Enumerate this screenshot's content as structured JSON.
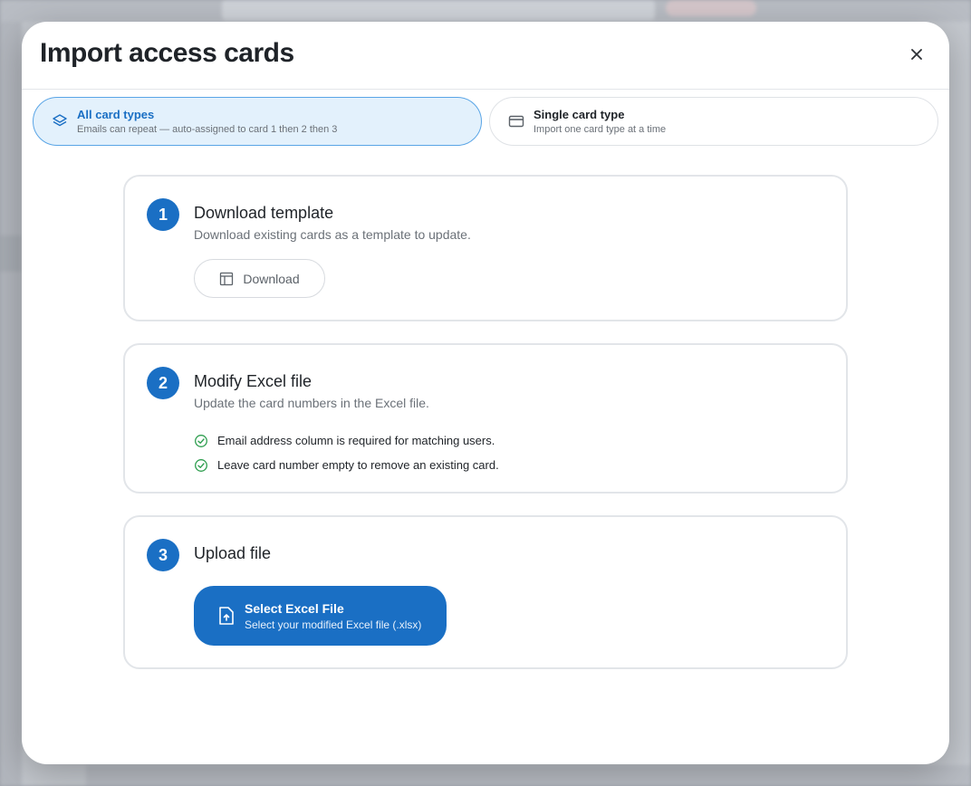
{
  "modal": {
    "title": "Import access cards",
    "close_icon": "close-icon"
  },
  "card_types": [
    {
      "label": "All card types",
      "description": "Emails can repeat — auto-assigned to card 1 then 2 then 3",
      "icon": "layers-icon",
      "selected": true
    },
    {
      "label": "Single card type",
      "description": "Import one card type at a time",
      "icon": "credit-card-icon",
      "selected": false
    }
  ],
  "steps": [
    {
      "number": "1",
      "title": "Download template",
      "description": "Download existing cards as a template to update.",
      "button_label": "Download",
      "button_icon": "table-icon"
    },
    {
      "number": "2",
      "title": "Modify Excel file",
      "description": "Update the card numbers in the Excel file.",
      "checks": [
        "Email address column is required for matching users.",
        "Leave card number empty to remove an existing card."
      ],
      "check_icon": "check-circle-icon"
    },
    {
      "number": "3",
      "title": "Upload file",
      "button_title": "Select Excel File",
      "button_subtitle": "Select your modified Excel file (.xlsx)",
      "button_icon": "file-upload-icon"
    }
  ],
  "colors": {
    "accent": "#1a6fc4",
    "selected_bg": "#e3f1fc",
    "check_green": "#2e9e4f"
  }
}
